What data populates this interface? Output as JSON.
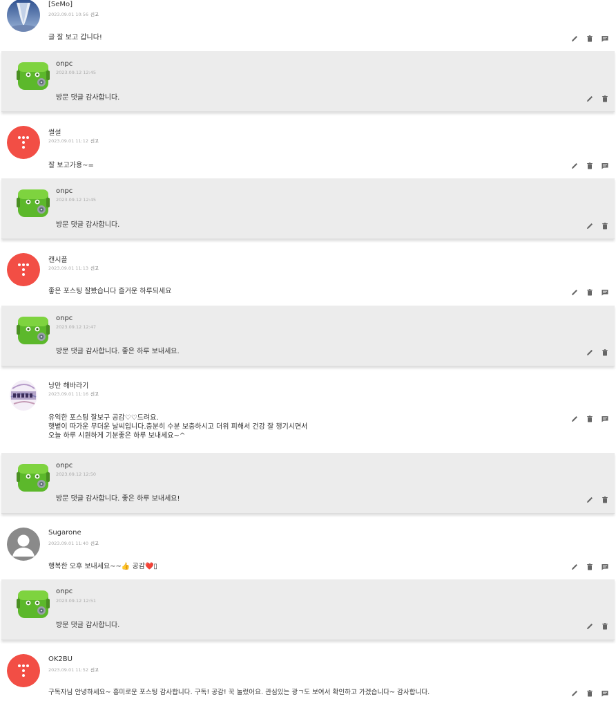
{
  "actions": {
    "edit_icon": "pencil-icon",
    "delete_icon": "trash-icon",
    "reply_icon": "comment-icon"
  },
  "colors": {
    "reply_bg": "#ececec",
    "red_avatar": "#f24e45",
    "green_avatar": "#5cb82b",
    "icon_gray": "#666666"
  },
  "threads": [
    {
      "comment": {
        "author": "[SeMo]",
        "date": "2023.09.01 10:56",
        "report": "신고",
        "text": "글 잘 보고 갑니다!",
        "avatar": "semo-avatar"
      },
      "reply": {
        "author": "onpc",
        "date": "2023.09.12 12:45",
        "text": "방문 댓글 감사합니다.",
        "avatar": "onpc-avatar"
      }
    },
    {
      "comment": {
        "author": "썰설",
        "date": "2023.09.01 11:12",
        "report": "신고",
        "text": "잘 보고가용~=",
        "avatar": "red-default-avatar"
      },
      "reply": {
        "author": "onpc",
        "date": "2023.09.12 12:45",
        "text": "방문 댓글 감사합니다.",
        "avatar": "onpc-avatar"
      }
    },
    {
      "comment": {
        "author": "캔시플",
        "date": "2023.09.01 11:13",
        "report": "신고",
        "text": "좋은 포스팅 잘봤습니다 즐거운 하루되세요",
        "avatar": "red-default-avatar"
      },
      "reply": {
        "author": "onpc",
        "date": "2023.09.12 12:47",
        "text": "방문 댓글 감사합니다. 좋은 하루 보내세요.",
        "avatar": "onpc-avatar"
      }
    },
    {
      "comment": {
        "author": "낭만 해바라기",
        "date": "2023.09.01 11:16",
        "report": "신고",
        "text": "유익한 포스팅 잘보구 공감♡♡드려요.\n햇볕이 따가운 무더운 날씨입니다.충분히 수분 보충하시고 더위 피해서 건강 잘 챙기시면서\n오늘 하루 시원하게 기분좋은 하루 보내세요~^",
        "avatar": "carpe-diem-avatar"
      },
      "reply": {
        "author": "onpc",
        "date": "2023.09.12 12:50",
        "text": "방문 댓글 감사합니다. 좋은 하루 보내세요!",
        "avatar": "onpc-avatar"
      }
    },
    {
      "comment": {
        "author": "Sugarone",
        "date": "2023.09.01 11:40",
        "report": "신고",
        "text": "행복한 오후 보내세요~~👍 공감❤️▯",
        "avatar": "gray-default-avatar"
      },
      "reply": {
        "author": "onpc",
        "date": "2023.09.12 12:51",
        "text": "방문 댓글 감사합니다.",
        "avatar": "onpc-avatar"
      }
    },
    {
      "comment": {
        "author": "OK2BU",
        "date": "2023.09.01 11:52",
        "report": "신고",
        "text": "구독자님 안녕하세요~ 흥미로운 포스팅 감사합니다. 구독! 공감! 꾹 눌렀어요. 관심있는 광ㄱ도 보여서 확인하고 가겠습니다~ 감사합니다.",
        "avatar": "red-default-avatar"
      }
    }
  ]
}
